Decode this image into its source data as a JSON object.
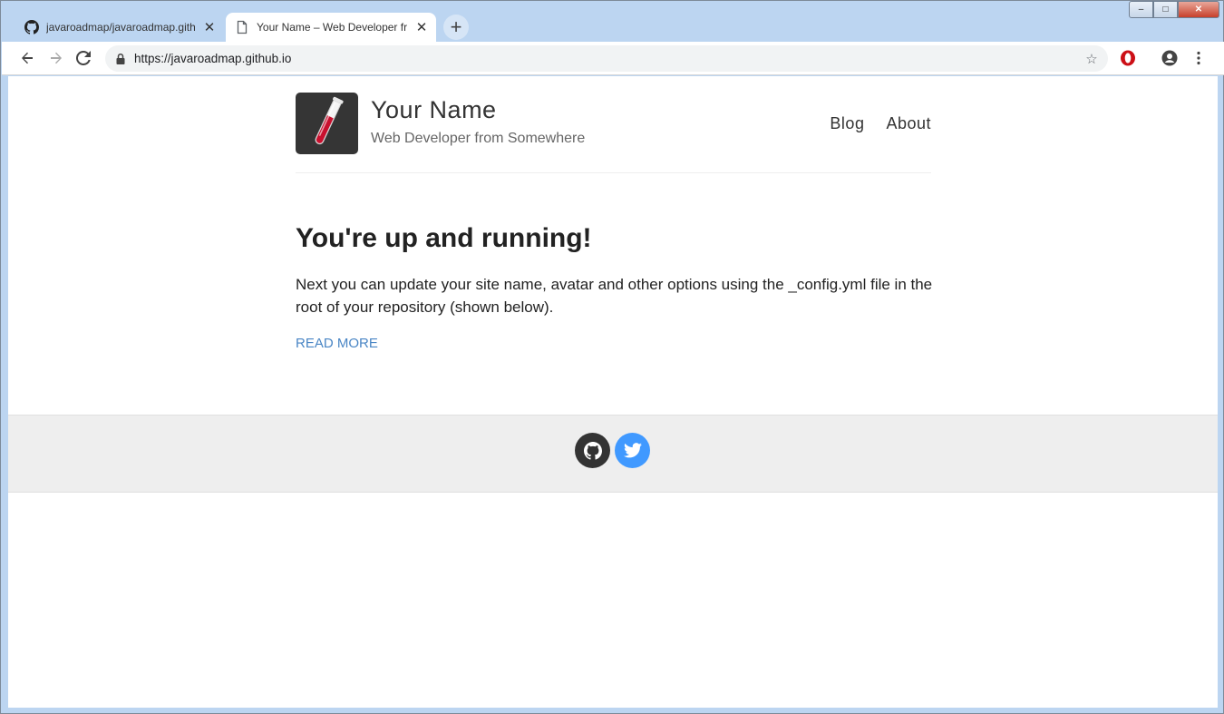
{
  "browser": {
    "tabs": [
      {
        "title": "javaroadmap/javaroadmap.github.io",
        "icon": "github-icon",
        "active": false
      },
      {
        "title": "Your Name – Web Developer from Somewhere",
        "icon": "page-icon",
        "active": true
      }
    ],
    "new_tab": "+",
    "window_controls": {
      "minimize": "–",
      "restore": "□",
      "close": "✕"
    },
    "url": "https://javaroadmap.github.io",
    "tab_close": "✕"
  },
  "site": {
    "name": "Your Name",
    "description": "Web Developer from Somewhere",
    "nav": [
      {
        "label": "Blog"
      },
      {
        "label": "About"
      }
    ]
  },
  "post": {
    "title": "You're up and running!",
    "excerpt": "Next you can update your site name, avatar and other options using the _config.yml file in the root of your repository (shown below).",
    "read_more": "READ MORE"
  },
  "footer": {
    "social": [
      {
        "name": "github",
        "color": "#333333"
      },
      {
        "name": "twitter",
        "color": "#4099ff"
      }
    ]
  },
  "colors": {
    "link": "#4a86c5",
    "chrome_frame": "#bcd5f1",
    "footer_bg": "#eeeeee",
    "opera_red": "#cc0f16"
  }
}
